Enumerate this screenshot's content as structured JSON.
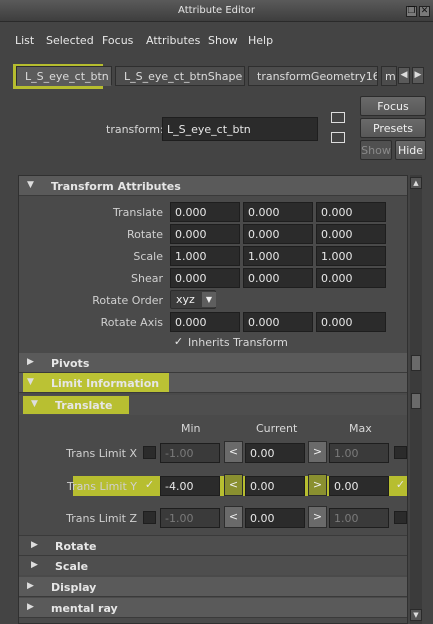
{
  "window": {
    "title": "Attribute Editor"
  },
  "menu": {
    "items": [
      "List",
      "Selected",
      "Focus",
      "Attributes",
      "Show",
      "Help"
    ]
  },
  "tabs": {
    "items": [
      "L_S_eye_ct_btn",
      "L_S_eye_ct_btnShape",
      "transformGeometry16",
      "m"
    ]
  },
  "node": {
    "label": "transform:",
    "value": "L_S_eye_ct_btn"
  },
  "buttons": {
    "focus": "Focus",
    "presets": "Presets",
    "show": "Show",
    "hide": "Hide"
  },
  "transform_attributes": {
    "header": "Transform Attributes",
    "rows": [
      {
        "label": "Translate",
        "values": [
          "0.000",
          "0.000",
          "0.000"
        ]
      },
      {
        "label": "Rotate",
        "values": [
          "0.000",
          "0.000",
          "0.000"
        ]
      },
      {
        "label": "Scale",
        "values": [
          "1.000",
          "1.000",
          "1.000"
        ]
      },
      {
        "label": "Shear",
        "values": [
          "0.000",
          "0.000",
          "0.000"
        ]
      }
    ],
    "rotate_order": {
      "label": "Rotate Order",
      "value": "xyz"
    },
    "rotate_axis": {
      "label": "Rotate Axis",
      "values": [
        "0.000",
        "0.000",
        "0.000"
      ]
    },
    "inherits_transform": {
      "label": "Inherits Transform",
      "checked": true
    }
  },
  "sections": {
    "pivots": "Pivots",
    "limit_information": "Limit Information",
    "translate": "Translate",
    "rotate": "Rotate",
    "scale": "Scale",
    "display": "Display",
    "mental_ray": "mental ray"
  },
  "limits": {
    "col_min": "Min",
    "col_current": "Current",
    "col_max": "Max",
    "rows": [
      {
        "label": "Trans Limit X",
        "min_checked": false,
        "min": "-1.00",
        "current": "0.00",
        "max": "1.00",
        "max_checked": false
      },
      {
        "label": "Trans Limit Y",
        "min_checked": true,
        "min": "-4.00",
        "current": "0.00",
        "max": "0.00",
        "max_checked": true
      },
      {
        "label": "Trans Limit Z",
        "min_checked": false,
        "min": "-1.00",
        "current": "0.00",
        "max": "1.00",
        "max_checked": false
      }
    ]
  },
  "glyphs": {
    "left": "<",
    "right": ">",
    "check": "✓",
    "open": "▼",
    "closed": "▶"
  },
  "highlight_color": "#dce628"
}
